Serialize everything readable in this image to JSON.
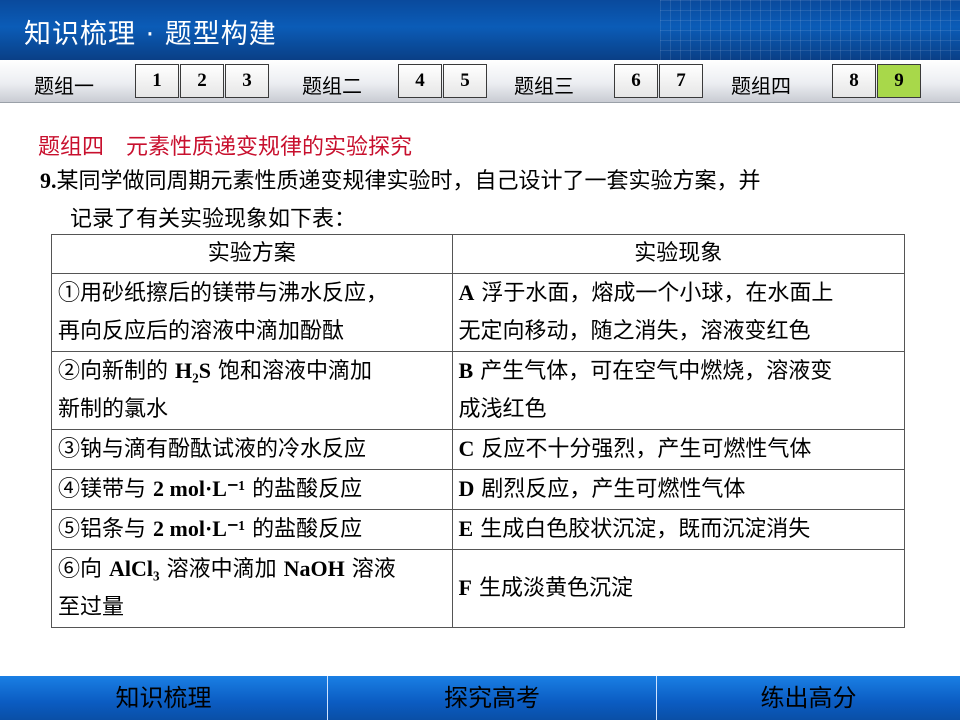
{
  "header": {
    "title": "知识梳理 · 题型构建"
  },
  "nav": {
    "groups": [
      {
        "label": "题组一",
        "buttons": [
          "1",
          "2",
          "3"
        ]
      },
      {
        "label": "题组二",
        "buttons": [
          "4",
          "5"
        ]
      },
      {
        "label": "题组三",
        "buttons": [
          "6",
          "7"
        ]
      },
      {
        "label": "题组四",
        "buttons": [
          "8",
          "9"
        ]
      }
    ],
    "active": "9"
  },
  "section_title": "题组四　元素性质递变规律的实验探究",
  "problem": {
    "number": "9.",
    "text_line1": "某同学做同周期元素性质递变规律实验时，自己设计了一套实验方案，并",
    "text_line2": "记录了有关实验现象如下表："
  },
  "table": {
    "headers": [
      "实验方案",
      "实验现象"
    ],
    "rows": [
      {
        "plan_a": "①用砂纸擦后的镁带与沸水反应，",
        "plan_b": "再向反应后的溶液中滴加酚酞",
        "key": "A",
        "obs": " 浮于水面，熔成一个小球，在水面上",
        "obs2": "无定向移动，随之消失，溶液变红色"
      },
      {
        "plan_a": "②向新制的 ",
        "chem": "H₂S",
        "plan_b": " 饱和溶液中滴加",
        "plan_c": "新制的氯水",
        "key": "B",
        "obs": " 产生气体，可在空气中燃烧，溶液变",
        "obs2": "成浅红色"
      },
      {
        "plan_a": "③钠与滴有酚酞试液的冷水反应",
        "key": "C",
        "obs": " 反应不十分强烈，产生可燃性气体"
      },
      {
        "plan_a": "④镁带与 ",
        "chem": "2 mol·L⁻¹",
        "plan_b": " 的盐酸反应",
        "key": "D",
        "obs": " 剧烈反应，产生可燃性气体"
      },
      {
        "plan_a": "⑤铝条与 ",
        "chem": "2 mol·L⁻¹",
        "plan_b": " 的盐酸反应",
        "key": "E",
        "obs": " 生成白色胶状沉淀，既而沉淀消失"
      },
      {
        "plan_a": "⑥向 ",
        "chem": "AlCl₃",
        "plan_b": " 溶液中滴加 ",
        "chem2": "NaOH",
        "plan_c": " 溶液",
        "plan_d": "至过量",
        "key": "F",
        "obs": " 生成淡黄色沉淀"
      }
    ]
  },
  "footer": {
    "items": [
      "知识梳理",
      "探究高考",
      "练出高分"
    ]
  }
}
